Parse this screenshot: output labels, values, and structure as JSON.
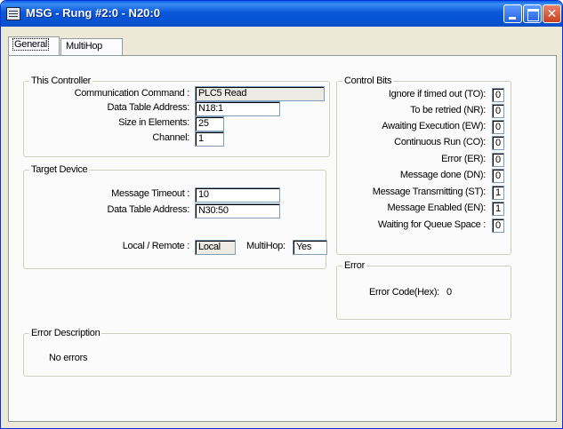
{
  "window": {
    "title": "MSG - Rung #2:0 - N20:0"
  },
  "tabs": [
    "General",
    "MultiHop"
  ],
  "this_controller": {
    "title": "This Controller",
    "communication_command": {
      "label": "Communication Command :",
      "value": "PLC5 Read"
    },
    "data_table_address": {
      "label": "Data Table Address:",
      "value": "N18:1"
    },
    "size_in_elements": {
      "label": "Size in Elements:",
      "value": "25"
    },
    "channel": {
      "label": "Channel:",
      "value": "1"
    }
  },
  "target_device": {
    "title": "Target Device",
    "message_timeout": {
      "label": "Message Timeout :",
      "value": "10"
    },
    "data_table_address": {
      "label": "Data Table Address:",
      "value": "N30:50"
    },
    "local_remote": {
      "label": "Local / Remote :",
      "value": "Local"
    },
    "multihop": {
      "label": "MultiHop:",
      "value": "Yes"
    }
  },
  "control_bits": {
    "title": "Control Bits",
    "items": [
      {
        "label": "Ignore if timed out (TO):",
        "value": "0"
      },
      {
        "label": "To be retried (NR):",
        "value": "0"
      },
      {
        "label": "Awaiting Execution (EW):",
        "value": "0"
      },
      {
        "label": "Continuous Run (CO):",
        "value": "0"
      },
      {
        "label": "Error (ER):",
        "value": "0"
      },
      {
        "label": "Message done (DN):",
        "value": "0"
      },
      {
        "label": "Message Transmitting (ST):",
        "value": "1"
      },
      {
        "label": "Message Enabled (EN):",
        "value": "1"
      },
      {
        "label": "Waiting for Queue Space :",
        "value": "0"
      }
    ]
  },
  "error": {
    "title": "Error",
    "code_label": "Error Code(Hex):",
    "code_value": "0"
  },
  "error_description": {
    "title": "Error Description",
    "text": "No errors"
  }
}
